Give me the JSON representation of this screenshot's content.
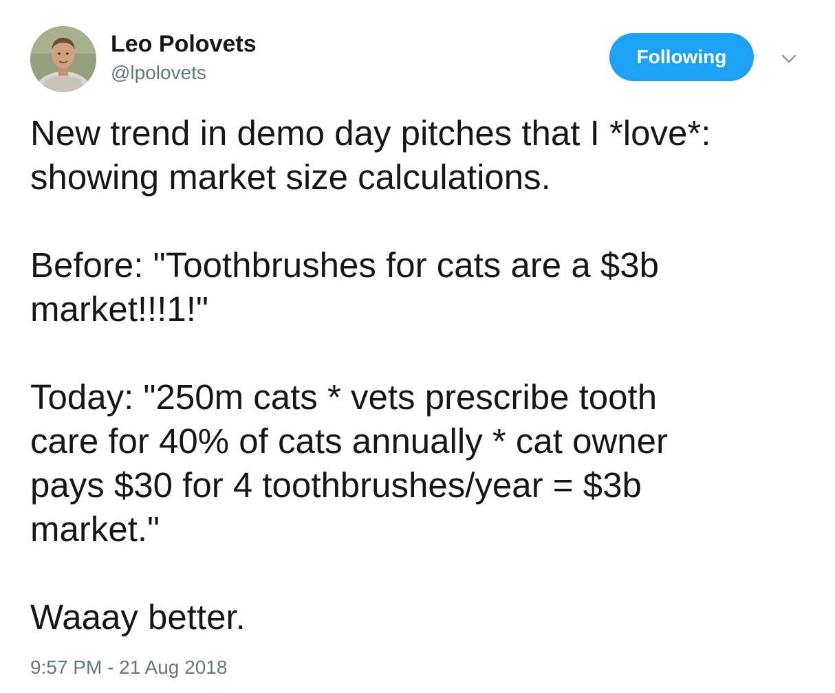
{
  "author": {
    "display_name": "Leo Polovets",
    "handle": "@lpolovets"
  },
  "follow_button": {
    "label": "Following"
  },
  "tweet": {
    "paragraphs": [
      "New trend in demo day pitches that I *love*:\nshowing market size calculations.",
      "Before: \"Toothbrushes for cats are a $3b\nmarket!!!1!\"",
      "Today: \"250m cats * vets prescribe tooth\ncare for 40% of cats annually * cat owner\npays $30 for 4 toothbrushes/year = $3b\nmarket.\"",
      "Waaay better."
    ],
    "timestamp": "9:57 PM - 21 Aug 2018"
  },
  "icons": {
    "menu": "chevron-down-icon",
    "avatar": "profile-photo"
  },
  "colors": {
    "accent": "#1da1f2",
    "text_primary": "#14171a",
    "text_secondary": "#657786"
  }
}
